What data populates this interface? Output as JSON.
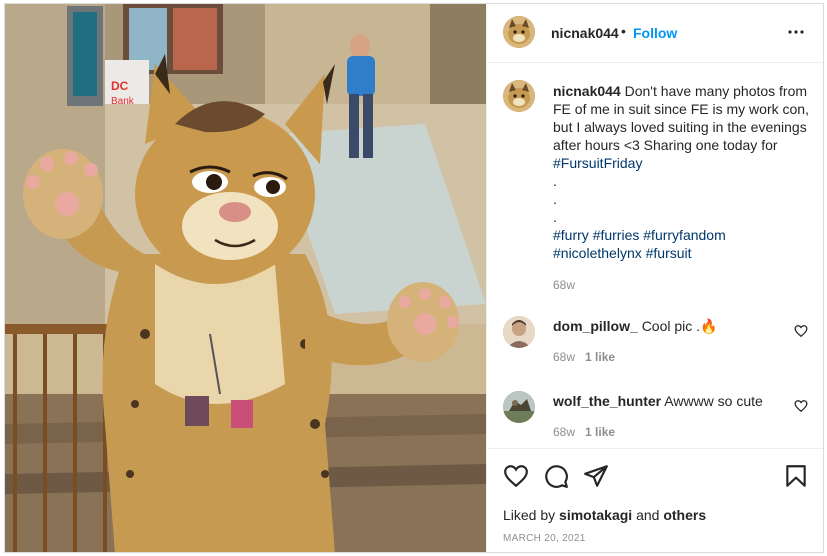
{
  "post": {
    "username": "nicnak044",
    "separator": "•",
    "follow_label": "Follow",
    "more_icon": "more-options-icon"
  },
  "caption": {
    "username": "nicnak044",
    "text": "Don't have many photos from FE of me in suit since FE is my work con, but I always loved suiting in the evenings after hours <3 Sharing one today for",
    "inline_tag": "#FursuitFriday",
    "dots": [
      ".",
      ".",
      "."
    ],
    "tags": [
      "#furry",
      "#furries",
      "#furryfandom",
      "#nicolethelynx",
      "#fursuit"
    ],
    "time": "68w"
  },
  "comments": [
    {
      "username": "dom_pillow_",
      "text": "Cool pic .",
      "emoji": "🔥",
      "time": "68w",
      "likes": "1 like"
    },
    {
      "username": "wolf_the_hunter",
      "text": "Awwww so cute",
      "emoji": "",
      "time": "68w",
      "likes": "1 like"
    }
  ],
  "actions": {
    "icons": [
      "heart-icon",
      "comment-icon",
      "share-icon",
      "bookmark-icon"
    ],
    "liked_prefix": "Liked by",
    "liked_user": "simotakagi",
    "liked_and": "and",
    "liked_others": "others",
    "date": "MARCH 20, 2021"
  },
  "photo": {
    "sign_brand": "DC",
    "sign_brand2": "Bank"
  },
  "colors": {
    "link_blue": "#0095f6",
    "hashtag": "#00376b",
    "muted": "#8e8e8e",
    "text": "#262626"
  }
}
